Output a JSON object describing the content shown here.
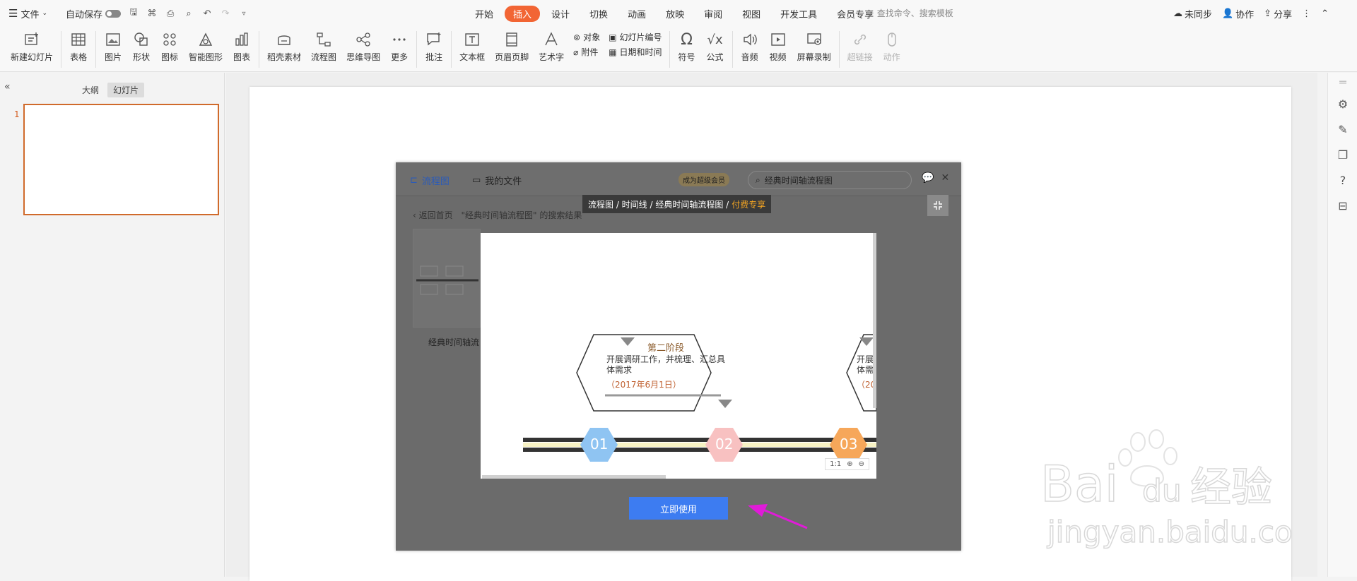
{
  "menubar": {
    "file_label": "文件",
    "autosave_label": "自动保存",
    "tabs": [
      "开始",
      "插入",
      "设计",
      "切换",
      "动画",
      "放映",
      "审阅",
      "视图",
      "开发工具",
      "会员专享"
    ],
    "active_tab_index": 1,
    "search_placeholder": "查找命令、搜索模板",
    "sync_label": "未同步",
    "collab_label": "协作",
    "share_label": "分享"
  },
  "ribbon": {
    "new_slide": "新建幻灯片",
    "table": "表格",
    "picture": "图片",
    "shape": "形状",
    "icon": "图标",
    "smartart": "智能图形",
    "chart": "图表",
    "docer": "稻壳素材",
    "flowchart": "流程图",
    "mindmap": "思维导图",
    "more": "更多",
    "comment": "批注",
    "textbox": "文本框",
    "header_footer": "页眉页脚",
    "wordart": "艺术字",
    "object": "对象",
    "attachment": "附件",
    "slide_number": "幻灯片编号",
    "datetime": "日期和时间",
    "symbol": "符号",
    "formula": "公式",
    "audio": "音频",
    "video": "视频",
    "screen_record": "屏幕录制",
    "hyperlink": "超链接",
    "action": "动作"
  },
  "left_panel": {
    "tab_outline": "大纲",
    "tab_slides": "幻灯片",
    "slide_number": "1"
  },
  "modal": {
    "flowchart_tab": "流程图",
    "my_files_tab": "我的文件",
    "vip_badge": "成为超级会员",
    "search_value": "经典时间轴流程图",
    "breadcrumb_path": "流程图 / 时间线 / 经典时间轴流程图 /",
    "breadcrumb_paid": "付费专享",
    "back_label": "返回首页",
    "results_text": "\"经典时间轴流程图\" 的搜索结果",
    "result_label": "经典时间轴流",
    "preview": {
      "stage_title": "第二阶段",
      "stage_desc_1": "开展调研工作，并梳理、汇总具",
      "stage_desc_2": "体需求",
      "stage_date": "（2017年6月1日）",
      "next_desc_1": "开展",
      "next_desc_2": "体需",
      "next_date": "（20",
      "numbers": [
        "01",
        "02",
        "03"
      ],
      "zoom_reset": "1:1"
    },
    "use_button": "立即使用"
  },
  "colors": {
    "accent": "#f26534",
    "primary_button": "#3d7cf1",
    "annotation_arrow": "#e01bd8",
    "num1": "#8fc4f2",
    "num2": "#f8c1c1",
    "num3": "#f6a75a"
  },
  "watermark": {
    "brand": "Baidu经验",
    "url": "jingyan.baidu.com"
  }
}
